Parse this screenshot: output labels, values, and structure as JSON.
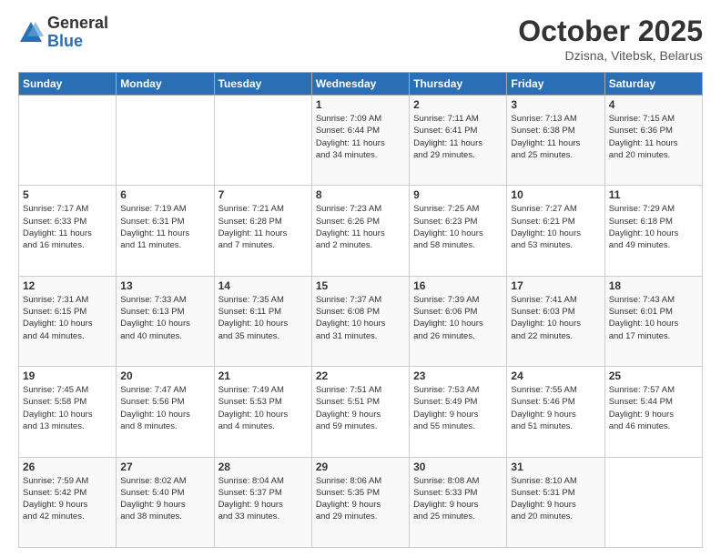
{
  "header": {
    "logo_general": "General",
    "logo_blue": "Blue",
    "month_title": "October 2025",
    "subtitle": "Dzisna, Vitebsk, Belarus"
  },
  "weekdays": [
    "Sunday",
    "Monday",
    "Tuesday",
    "Wednesday",
    "Thursday",
    "Friday",
    "Saturday"
  ],
  "weeks": [
    [
      {
        "day": "",
        "info": ""
      },
      {
        "day": "",
        "info": ""
      },
      {
        "day": "",
        "info": ""
      },
      {
        "day": "1",
        "info": "Sunrise: 7:09 AM\nSunset: 6:44 PM\nDaylight: 11 hours\nand 34 minutes."
      },
      {
        "day": "2",
        "info": "Sunrise: 7:11 AM\nSunset: 6:41 PM\nDaylight: 11 hours\nand 29 minutes."
      },
      {
        "day": "3",
        "info": "Sunrise: 7:13 AM\nSunset: 6:38 PM\nDaylight: 11 hours\nand 25 minutes."
      },
      {
        "day": "4",
        "info": "Sunrise: 7:15 AM\nSunset: 6:36 PM\nDaylight: 11 hours\nand 20 minutes."
      }
    ],
    [
      {
        "day": "5",
        "info": "Sunrise: 7:17 AM\nSunset: 6:33 PM\nDaylight: 11 hours\nand 16 minutes."
      },
      {
        "day": "6",
        "info": "Sunrise: 7:19 AM\nSunset: 6:31 PM\nDaylight: 11 hours\nand 11 minutes."
      },
      {
        "day": "7",
        "info": "Sunrise: 7:21 AM\nSunset: 6:28 PM\nDaylight: 11 hours\nand 7 minutes."
      },
      {
        "day": "8",
        "info": "Sunrise: 7:23 AM\nSunset: 6:26 PM\nDaylight: 11 hours\nand 2 minutes."
      },
      {
        "day": "9",
        "info": "Sunrise: 7:25 AM\nSunset: 6:23 PM\nDaylight: 10 hours\nand 58 minutes."
      },
      {
        "day": "10",
        "info": "Sunrise: 7:27 AM\nSunset: 6:21 PM\nDaylight: 10 hours\nand 53 minutes."
      },
      {
        "day": "11",
        "info": "Sunrise: 7:29 AM\nSunset: 6:18 PM\nDaylight: 10 hours\nand 49 minutes."
      }
    ],
    [
      {
        "day": "12",
        "info": "Sunrise: 7:31 AM\nSunset: 6:15 PM\nDaylight: 10 hours\nand 44 minutes."
      },
      {
        "day": "13",
        "info": "Sunrise: 7:33 AM\nSunset: 6:13 PM\nDaylight: 10 hours\nand 40 minutes."
      },
      {
        "day": "14",
        "info": "Sunrise: 7:35 AM\nSunset: 6:11 PM\nDaylight: 10 hours\nand 35 minutes."
      },
      {
        "day": "15",
        "info": "Sunrise: 7:37 AM\nSunset: 6:08 PM\nDaylight: 10 hours\nand 31 minutes."
      },
      {
        "day": "16",
        "info": "Sunrise: 7:39 AM\nSunset: 6:06 PM\nDaylight: 10 hours\nand 26 minutes."
      },
      {
        "day": "17",
        "info": "Sunrise: 7:41 AM\nSunset: 6:03 PM\nDaylight: 10 hours\nand 22 minutes."
      },
      {
        "day": "18",
        "info": "Sunrise: 7:43 AM\nSunset: 6:01 PM\nDaylight: 10 hours\nand 17 minutes."
      }
    ],
    [
      {
        "day": "19",
        "info": "Sunrise: 7:45 AM\nSunset: 5:58 PM\nDaylight: 10 hours\nand 13 minutes."
      },
      {
        "day": "20",
        "info": "Sunrise: 7:47 AM\nSunset: 5:56 PM\nDaylight: 10 hours\nand 8 minutes."
      },
      {
        "day": "21",
        "info": "Sunrise: 7:49 AM\nSunset: 5:53 PM\nDaylight: 10 hours\nand 4 minutes."
      },
      {
        "day": "22",
        "info": "Sunrise: 7:51 AM\nSunset: 5:51 PM\nDaylight: 9 hours\nand 59 minutes."
      },
      {
        "day": "23",
        "info": "Sunrise: 7:53 AM\nSunset: 5:49 PM\nDaylight: 9 hours\nand 55 minutes."
      },
      {
        "day": "24",
        "info": "Sunrise: 7:55 AM\nSunset: 5:46 PM\nDaylight: 9 hours\nand 51 minutes."
      },
      {
        "day": "25",
        "info": "Sunrise: 7:57 AM\nSunset: 5:44 PM\nDaylight: 9 hours\nand 46 minutes."
      }
    ],
    [
      {
        "day": "26",
        "info": "Sunrise: 7:59 AM\nSunset: 5:42 PM\nDaylight: 9 hours\nand 42 minutes."
      },
      {
        "day": "27",
        "info": "Sunrise: 8:02 AM\nSunset: 5:40 PM\nDaylight: 9 hours\nand 38 minutes."
      },
      {
        "day": "28",
        "info": "Sunrise: 8:04 AM\nSunset: 5:37 PM\nDaylight: 9 hours\nand 33 minutes."
      },
      {
        "day": "29",
        "info": "Sunrise: 8:06 AM\nSunset: 5:35 PM\nDaylight: 9 hours\nand 29 minutes."
      },
      {
        "day": "30",
        "info": "Sunrise: 8:08 AM\nSunset: 5:33 PM\nDaylight: 9 hours\nand 25 minutes."
      },
      {
        "day": "31",
        "info": "Sunrise: 8:10 AM\nSunset: 5:31 PM\nDaylight: 9 hours\nand 20 minutes."
      },
      {
        "day": "",
        "info": ""
      }
    ]
  ]
}
